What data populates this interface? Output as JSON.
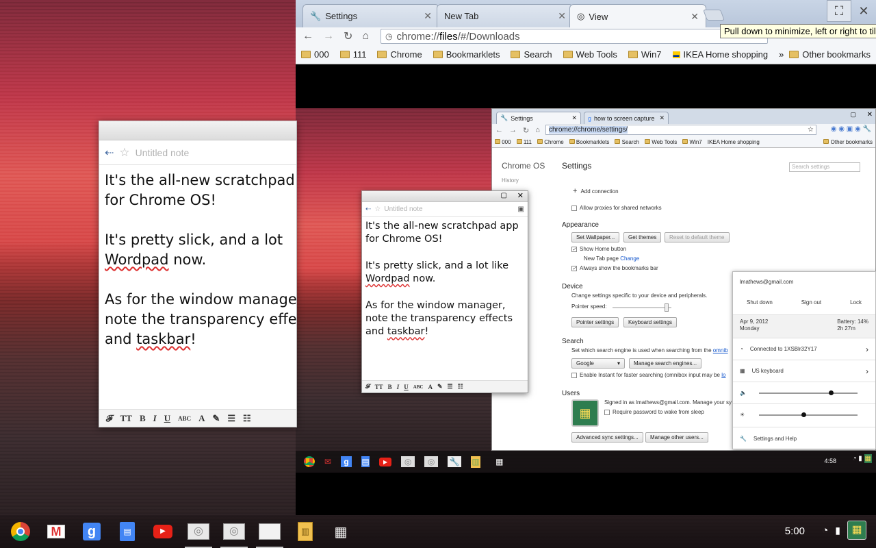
{
  "colors": {
    "accent": "#4285f4",
    "tab_active": "#f4f6f9",
    "bookmark_folder": "#e5c063",
    "tooltip_bg": "#ffffe1",
    "shelf": "#1e1618"
  },
  "note": {
    "title_placeholder": "Untitled note",
    "body": "It's the all-new scratchpad app for Chrome OS!\n\nIt's pretty slick, and a lot like Wordpad now.\n\nAs for the window manager, note the transparency effects and taskbar!",
    "big_lines": [
      "It's the all-new scratchpad",
      "for Chrome OS!",
      "",
      "It's pretty slick, and a lot",
      "Wordpad now.",
      "",
      "As for the window manage",
      "note the transparency effe",
      "and taskbar!"
    ],
    "format_buttons": [
      "F",
      "TT",
      "B",
      "I",
      "U",
      "ABC",
      "A",
      "eraser",
      "bullets",
      "numbers"
    ]
  },
  "small_note_lines": [
    "It's the all-new scratchpad app",
    "for Chrome OS!",
    "",
    "It's pretty slick, and a lot like",
    "Wordpad now.",
    "",
    "As for the window manager,",
    "note the transparency effects",
    "and taskbar!"
  ],
  "browser": {
    "tabs": [
      {
        "label": "Settings",
        "icon": "wrench-icon"
      },
      {
        "label": "New Tab",
        "icon": ""
      },
      {
        "label": "View",
        "icon": "globe-icon"
      }
    ],
    "url_prefix": "chrome://",
    "url_host": "files",
    "url_rest": "/#/Downloads",
    "tooltip": "Pull down to minimize, left or right to tile",
    "bookmarks": [
      "000",
      "111",
      "Chrome",
      "Bookmarklets",
      "Search",
      "Web Tools",
      "Win7",
      "IKEA Home shopping"
    ],
    "other_bookmarks": "Other bookmarks",
    "chevron": "»"
  },
  "inner": {
    "tabs": [
      "Settings",
      "how to screen capture cr"
    ],
    "url": "chrome://chrome/settings/",
    "bookmarks": [
      "000",
      "111",
      "Chrome",
      "Bookmarklets",
      "Search",
      "Web Tools",
      "Win7",
      "IKEA Home shopping"
    ],
    "other_bookmarks": "Other bookmarks",
    "settings": {
      "brand": "Chrome OS",
      "history": "History",
      "title": "Settings",
      "search_placeholder": "Search settings",
      "add_connection": "Add connection",
      "allow_proxies": "Allow proxies for shared networks",
      "appearance": "Appearance",
      "set_wallpaper": "Set Wallpaper...",
      "get_themes": "Get themes",
      "reset_theme": "Reset to default theme",
      "show_home": "Show Home button",
      "new_tab_page": "New Tab page",
      "change": "Change",
      "always_bookmarks": "Always show the bookmarks bar",
      "device": "Device",
      "device_desc": "Change settings specific to your device and peripherals.",
      "pointer_speed": "Pointer speed:",
      "pointer_settings": "Pointer settings",
      "keyboard_settings": "Keyboard settings",
      "search": "Search",
      "search_desc": "Set which search engine is used when searching from the",
      "omnibox": "omnib",
      "engine": "Google",
      "manage_engines": "Manage search engines...",
      "instant": "Enable Instant for faster searching (omnibox input may be",
      "instant_link": "lo",
      "users": "Users",
      "signed_in": "Signed in as lmathews@gmail.com. Manage your sy",
      "require_password": "Require password to wake from sleep",
      "advanced_sync": "Advanced sync settings...",
      "manage_users": "Manage other users..."
    },
    "status": {
      "email": "lmathews@gmail.com",
      "shutdown": "Shut down",
      "signout": "Sign out",
      "lock": "Lock",
      "date": "Apr 9, 2012",
      "day": "Monday",
      "battery": "Battery: 14%",
      "battery_time": "2h 27m",
      "network": "Connected to 1XSBlr32Y17",
      "keyboard": "US keyboard",
      "volume": 0.73,
      "brightness": 0.45,
      "settings_help": "Settings and Help"
    },
    "clock": "4:58"
  },
  "shelf": {
    "apps": [
      "chrome-icon",
      "gmail-icon",
      "google-search-icon",
      "docs-icon",
      "youtube-icon",
      "window-icon",
      "window-icon",
      "window-icon",
      "scratchpad-icon",
      "app-launcher-icon"
    ],
    "clock": "5:00"
  }
}
